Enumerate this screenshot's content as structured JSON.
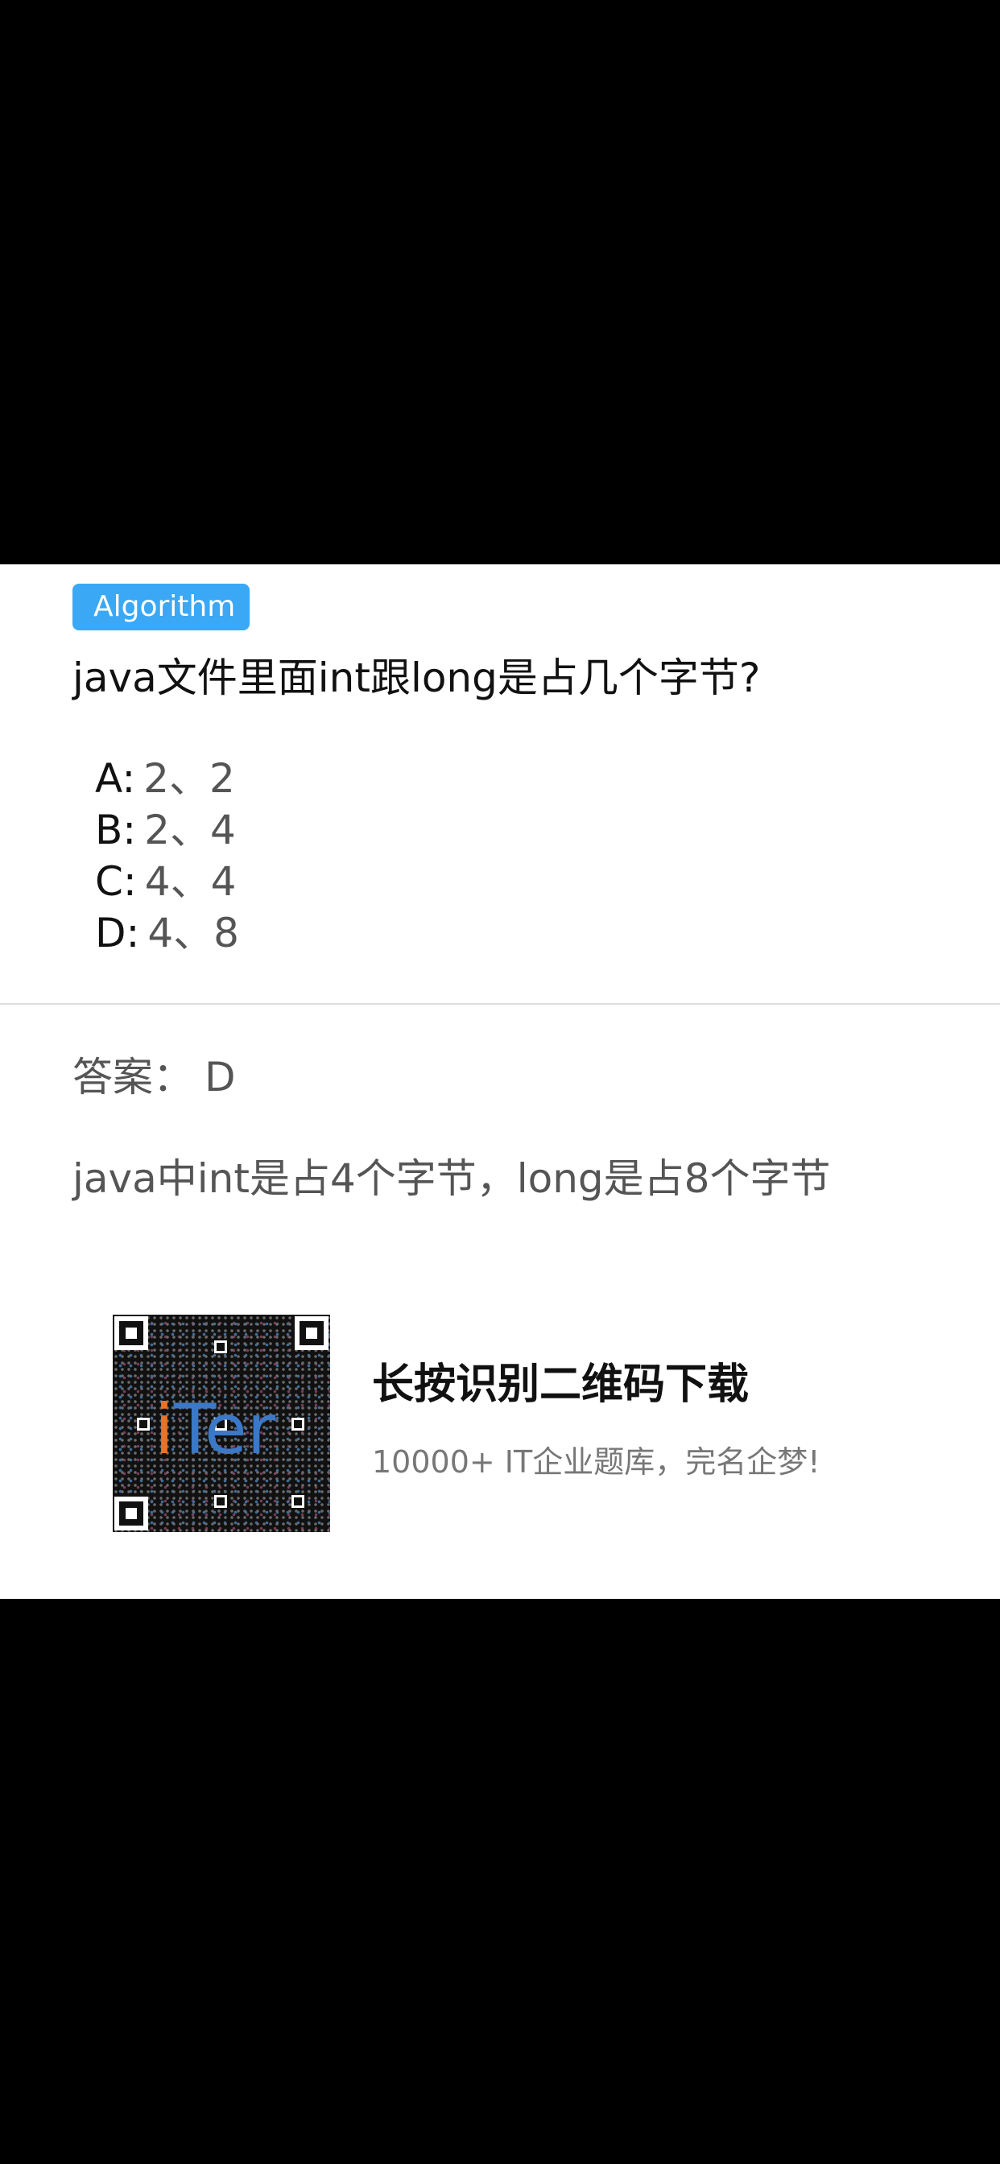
{
  "colors": {
    "tag_background": "#3aa8f5",
    "logo_i": "#e8732a",
    "logo_text": "#3a78c8"
  },
  "question": {
    "tag": "Algorithm",
    "text": "java文件里面int跟long是占几个字节?",
    "options": [
      {
        "key": "A:",
        "value": "2、2"
      },
      {
        "key": "B:",
        "value": "2、4"
      },
      {
        "key": "C:",
        "value": "4、4"
      },
      {
        "key": "D:",
        "value": "4、8"
      }
    ]
  },
  "answer": {
    "label": "答案：",
    "value": "D",
    "explanation": "java中int是占4个字节，long是占8个字节"
  },
  "promo": {
    "qr_logo_i": "i",
    "qr_logo_rest": "Ter",
    "title": "长按识别二维码下载",
    "subtitle": "10000+ IT企业题库，完名企梦!"
  }
}
